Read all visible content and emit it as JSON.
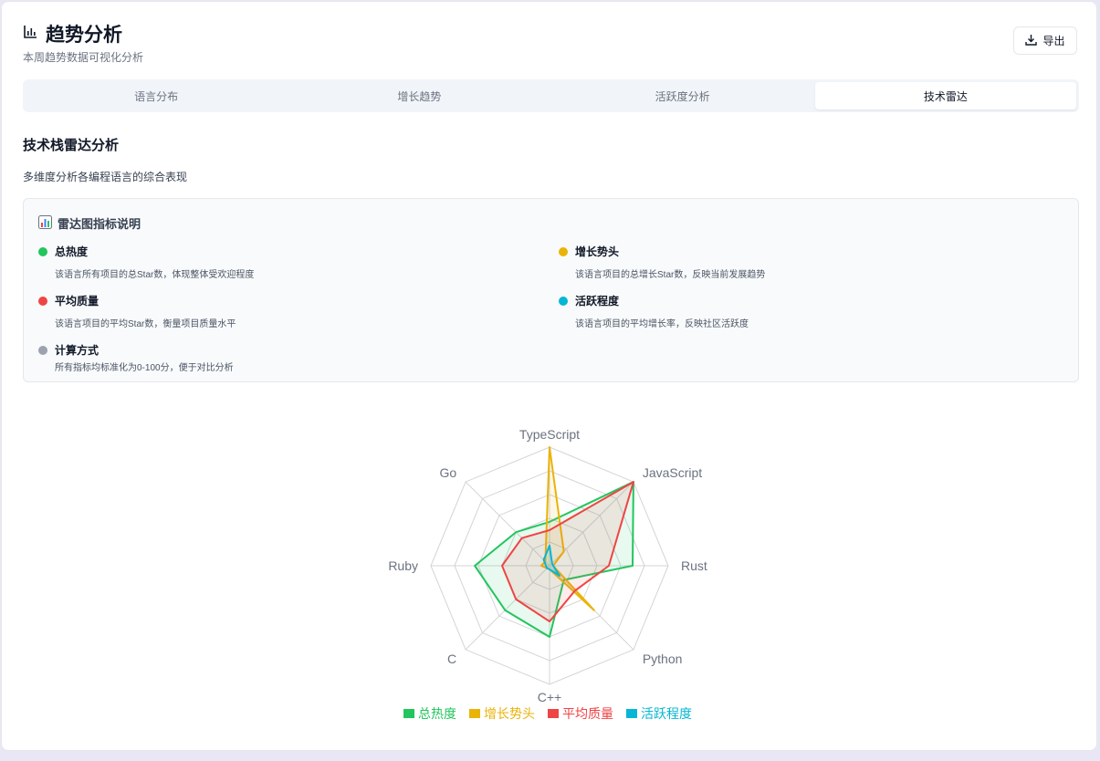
{
  "header": {
    "title": "趋势分析",
    "subtitle": "本周趋势数据可视化分析",
    "export_label": "导出"
  },
  "tabs": [
    {
      "label": "语言分布",
      "active": false
    },
    {
      "label": "增长趋势",
      "active": false
    },
    {
      "label": "活跃度分析",
      "active": false
    },
    {
      "label": "技术雷达",
      "active": true
    }
  ],
  "section": {
    "title": "技术栈雷达分析",
    "description": "多维度分析各编程语言的综合表现"
  },
  "legend_box": {
    "title": "雷达图指标说明",
    "metrics": [
      {
        "name": "总热度",
        "desc": "该语言所有项目的总Star数，体现整体受欢迎程度",
        "color": "#22c55e"
      },
      {
        "name": "增长势头",
        "desc": "该语言项目的总增长Star数，反映当前发展趋势",
        "color": "#eab308"
      },
      {
        "name": "平均质量",
        "desc": "该语言项目的平均Star数，衡量项目质量水平",
        "color": "#ef4444"
      },
      {
        "name": "活跃程度",
        "desc": "该语言项目的平均增长率，反映社区活跃度",
        "color": "#06b6d4"
      },
      {
        "name": "计算方式",
        "desc": "所有指标均标准化为0-100分，便于对比分析",
        "color": "#9ca3af"
      }
    ]
  },
  "chart_data": {
    "type": "radar",
    "indicators": [
      "TypeScript",
      "JavaScript",
      "Rust",
      "Python",
      "C++",
      "C",
      "Ruby",
      "Go"
    ],
    "max": 100,
    "series": [
      {
        "name": "总热度",
        "color": "#22c55e",
        "values": [
          37,
          100,
          70,
          17,
          60,
          53,
          63,
          40
        ]
      },
      {
        "name": "增长势头",
        "color": "#eab308",
        "values": [
          100,
          17,
          3,
          53,
          3,
          3,
          7,
          5
        ]
      },
      {
        "name": "平均质量",
        "color": "#ef4444",
        "values": [
          30,
          100,
          50,
          30,
          47,
          40,
          40,
          33
        ]
      },
      {
        "name": "活跃程度",
        "color": "#06b6d4",
        "values": [
          17,
          3,
          3,
          12,
          3,
          3,
          3,
          7
        ]
      }
    ],
    "legend_position": "bottom"
  }
}
